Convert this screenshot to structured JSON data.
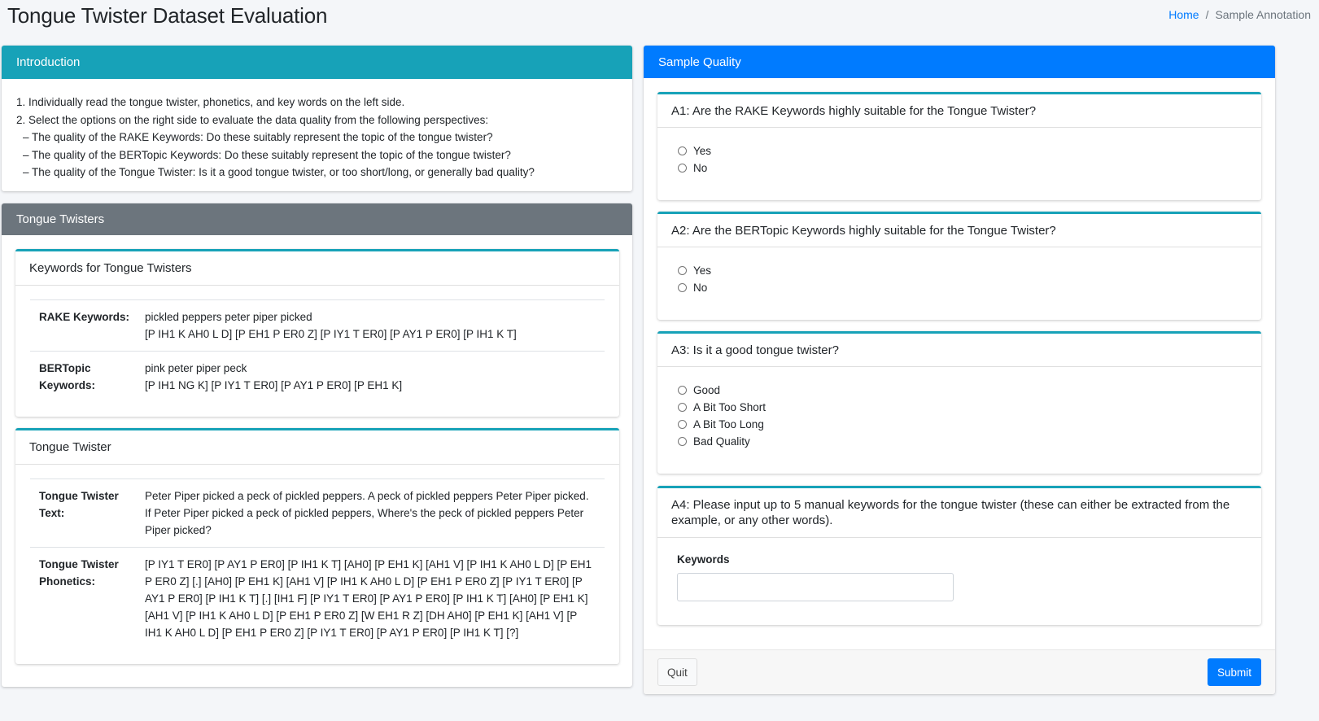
{
  "page": {
    "title": "Tongue Twister Dataset Evaluation"
  },
  "breadcrumb": {
    "home": "Home",
    "separator": "/",
    "current": "Sample Annotation"
  },
  "intro": {
    "header": "Introduction",
    "lines": [
      "1. Individually read the tongue twister, phonetics, and key words on the left side.",
      "2. Select the options on the right side to evaluate the data quality from the following perspectives:",
      "– The quality of the RAKE Keywords: Do these suitably represent the topic of the tongue twister?",
      "– The quality of the BERTopic Keywords: Do these suitably represent the topic of the tongue twister?",
      "– The quality of the Tongue Twister: Is it a good tongue twister, or too short/long, or generally bad quality?"
    ]
  },
  "twisters": {
    "header": "Tongue Twisters",
    "keywords_card": {
      "header": "Keywords for Tongue Twisters",
      "rake_label": "RAKE Keywords:",
      "rake_words": "pickled peppers peter piper picked",
      "rake_phonetics": "[P IH1 K AH0 L D] [P EH1 P ER0 Z] [P IY1 T ER0] [P AY1 P ER0] [P IH1 K T]",
      "bert_label_1": "BERTopic",
      "bert_label_2": "Keywords:",
      "bert_words": "pink peter piper peck",
      "bert_phonetics": "[P IH1 NG K] [P IY1 T ER0] [P AY1 P ER0] [P EH1 K]"
    },
    "twister_card": {
      "header": "Tongue Twister",
      "text_label_1": "Tongue Twister",
      "text_label_2": "Text:",
      "text": "Peter Piper picked a peck of pickled peppers. A peck of pickled peppers Peter Piper picked. If Peter Piper picked a peck of pickled peppers, Where's the peck of pickled peppers Peter Piper picked?",
      "phon_label_1": "Tongue Twister",
      "phon_label_2": "Phonetics:",
      "phonetics": "[P IY1 T ER0] [P AY1 P ER0] [P IH1 K T] [AH0] [P EH1 K] [AH1 V] [P IH1 K AH0 L D] [P EH1 P ER0 Z] [.] [AH0] [P EH1 K] [AH1 V] [P IH1 K AH0 L D] [P EH1 P ER0 Z] [P IY1 T ER0] [P AY1 P ER0] [P IH1 K T] [.] [IH1 F] [P IY1 T ER0] [P AY1 P ER0] [P IH1 K T] [AH0] [P EH1 K] [AH1 V] [P IH1 K AH0 L D] [P EH1 P ER0 Z] [W EH1 R Z] [DH AH0] [P EH1 K] [AH1 V] [P IH1 K AH0 L D] [P EH1 P ER0 Z] [P IY1 T ER0] [P AY1 P ER0] [P IH1 K T] [?]"
    }
  },
  "quality": {
    "header": "Sample Quality",
    "a1": {
      "question": "A1: Are the RAKE Keywords highly suitable for the Tongue Twister?",
      "options": [
        "Yes",
        "No"
      ]
    },
    "a2": {
      "question": "A2: Are the BERTopic Keywords highly suitable for the Tongue Twister?",
      "options": [
        "Yes",
        "No"
      ]
    },
    "a3": {
      "question": "A3: Is it a good tongue twister?",
      "options": [
        "Good",
        "A Bit Too Short",
        "A Bit Too Long",
        "Bad Quality"
      ]
    },
    "a4": {
      "question": "A4: Please input up to 5 manual keywords for the tongue twister (these can either be extracted from the example, or any other words).",
      "field_label": "Keywords",
      "value": ""
    },
    "quit_label": "Quit",
    "submit_label": "Submit"
  },
  "colors": {
    "info": "#17a2b8",
    "secondary": "#6c757d",
    "primary": "#007bff"
  }
}
